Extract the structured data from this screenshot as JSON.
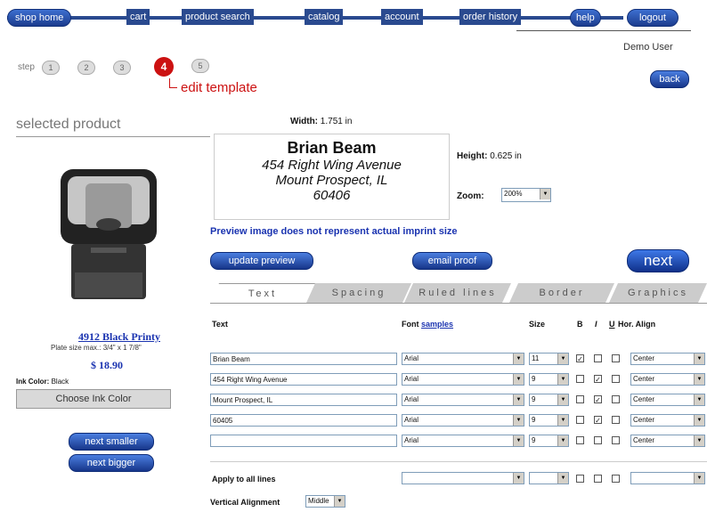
{
  "nav": {
    "items": [
      "shop home",
      "cart",
      "product search",
      "catalog",
      "account",
      "order history",
      "help"
    ],
    "logout": "logout"
  },
  "user": "Demo User",
  "steps": {
    "label": "step",
    "numbers": [
      "1",
      "2",
      "3",
      "4",
      "5"
    ],
    "current": "4",
    "current_title": "edit template"
  },
  "back_label": "back",
  "selected_product_label": "selected product",
  "product": {
    "name": "4912 Black Printy",
    "plate_size": "Plate size max.: 3/4\" x 1 7/8\"",
    "price": "$ 18.90",
    "ink_label": "Ink Color:",
    "ink_value": "Black",
    "choose_ink": "Choose Ink Color",
    "next_smaller": "next smaller",
    "next_bigger": "next bigger"
  },
  "preview": {
    "width_label": "Width:",
    "width_value": "1.751 in",
    "height_label": "Height:",
    "height_value": "0.625 in",
    "zoom_label": "Zoom:",
    "zoom_value": "200%",
    "lines": [
      "Brian Beam",
      "454 Right Wing Avenue",
      "Mount Prospect, IL",
      "60406"
    ],
    "notice": "Preview image does not represent actual imprint size",
    "update_btn": "update preview",
    "email_btn": "email proof",
    "next_btn": "next"
  },
  "tabs": [
    "Text",
    "Spacing",
    "Ruled lines",
    "Border",
    "Graphics"
  ],
  "table": {
    "headers": {
      "text": "Text",
      "font": "Font",
      "samples": "samples",
      "size": "Size",
      "b": "B",
      "i": "I",
      "u": "U",
      "align": "Hor. Align"
    },
    "rows": [
      {
        "text": "Brian Beam",
        "font": "Arial",
        "size": "11",
        "b": true,
        "i": false,
        "u": false,
        "align": "Center"
      },
      {
        "text": "454 Right Wing Avenue",
        "font": "Arial",
        "size": "9",
        "b": false,
        "i": true,
        "u": false,
        "align": "Center"
      },
      {
        "text": "Mount Prospect, IL",
        "font": "Arial",
        "size": "9",
        "b": false,
        "i": true,
        "u": false,
        "align": "Center"
      },
      {
        "text": "60405",
        "font": "Arial",
        "size": "9",
        "b": false,
        "i": true,
        "u": false,
        "align": "Center"
      },
      {
        "text": "",
        "font": "Arial",
        "size": "9",
        "b": false,
        "i": false,
        "u": false,
        "align": "Center"
      }
    ],
    "apply_all": "Apply to all lines",
    "vertical_label": "Vertical Alignment",
    "vertical_value": "Middle"
  }
}
